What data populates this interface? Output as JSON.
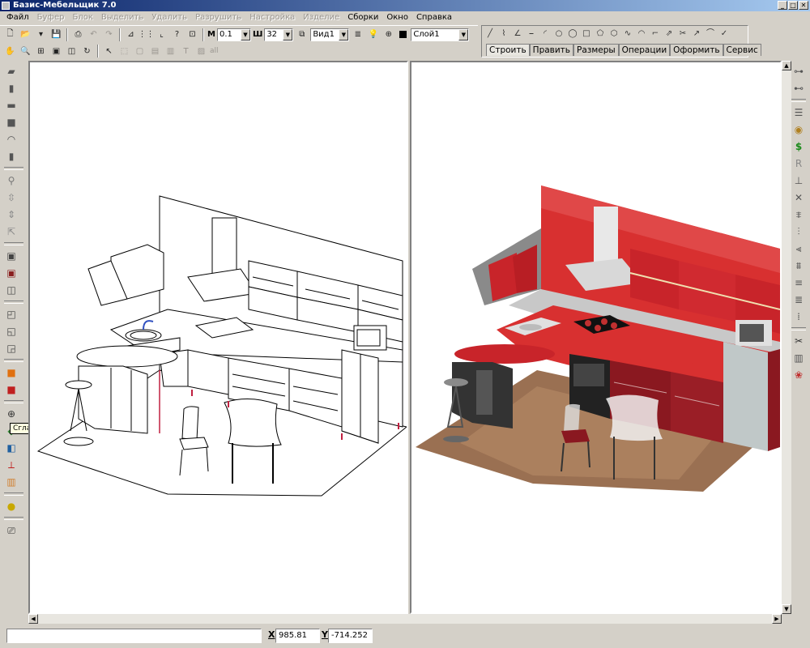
{
  "window": {
    "title": "Базис-Мебельщик 7.0"
  },
  "menu": [
    {
      "label": "Файл",
      "enabled": true
    },
    {
      "label": "Буфер",
      "enabled": false
    },
    {
      "label": "Блок",
      "enabled": false
    },
    {
      "label": "Выделить",
      "enabled": false
    },
    {
      "label": "Удалить",
      "enabled": false
    },
    {
      "label": "Разрушить",
      "enabled": false
    },
    {
      "label": "Настройка",
      "enabled": false
    },
    {
      "label": "Изделие",
      "enabled": false
    },
    {
      "label": "Сборки",
      "enabled": true
    },
    {
      "label": "Окно",
      "enabled": true
    },
    {
      "label": "Справка",
      "enabled": true
    }
  ],
  "toolbar": {
    "m_label": "М",
    "m_value": "0.1",
    "w_label": "Ш",
    "w_value": "32",
    "view_value": "Вид1",
    "layer_value": "Слой1",
    "row2_text": "all"
  },
  "tabs": [
    "Строить",
    "Править",
    "Размеры",
    "Операции",
    "Оформить",
    "Сервис"
  ],
  "tooltip": "Сглаживание",
  "status": {
    "x_label": "X",
    "x_value": "985.81",
    "y_label": "Y",
    "y_value": "-714.252"
  },
  "colors": {
    "accent_red": "#c8242a",
    "wall_red": "#d83030",
    "floor_brown": "#9a7052",
    "title_blue": "#0a246a"
  },
  "icons": {
    "left_panel": [
      "panel-icon",
      "panel-icon",
      "panel-icon",
      "panel-icon",
      "bend-icon",
      "panel-icon",
      "screw-icon",
      "align-icon",
      "align-icon",
      "move-icon",
      "box-icon",
      "box-icon",
      "box-icon",
      "box-icon",
      "box-icon",
      "box-icon",
      "cube-icon",
      "cube-icon",
      "compass-icon",
      "smooth-icon",
      "box-icon",
      "axis-icon",
      "texture-icon",
      "lamp-icon",
      "camera-icon"
    ],
    "right_panel": [
      "tree-icon",
      "tree-icon",
      "list-icon",
      "coins-icon",
      "dollar-icon",
      "r-icon",
      "measure-icon",
      "cut-icon",
      "pattern-icon",
      "pattern-icon",
      "pattern-icon",
      "pattern-icon",
      "pattern-icon",
      "pattern-icon",
      "pattern-icon",
      "scissors-icon",
      "cabinet-icon",
      "palette-icon"
    ]
  }
}
